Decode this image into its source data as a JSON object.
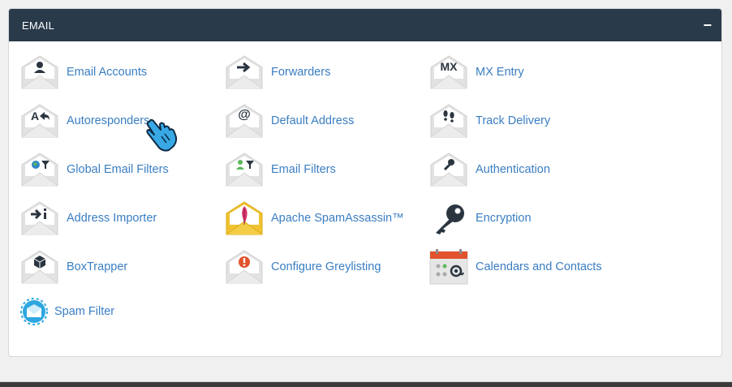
{
  "panel": {
    "title": "EMAIL",
    "collapse_symbol": "−"
  },
  "items": [
    {
      "label": "Email Accounts",
      "icon": "user-envelope-icon"
    },
    {
      "label": "Forwarders",
      "icon": "arrow-right-envelope-icon"
    },
    {
      "label": "MX Entry",
      "icon": "mx-envelope-icon",
      "glyph": "MX"
    },
    {
      "label": "Autoresponders",
      "icon": "reply-envelope-icon",
      "glyph": "A"
    },
    {
      "label": "Default Address",
      "icon": "at-envelope-icon",
      "glyph": "@"
    },
    {
      "label": "Track Delivery",
      "icon": "footprints-envelope-icon"
    },
    {
      "label": "Global Email Filters",
      "icon": "globe-filter-envelope-icon"
    },
    {
      "label": "Email Filters",
      "icon": "user-filter-envelope-icon"
    },
    {
      "label": "Authentication",
      "icon": "key-envelope-icon"
    },
    {
      "label": "Address Importer",
      "icon": "import-envelope-icon"
    },
    {
      "label": "Apache SpamAssassin™",
      "icon": "feather-envelope-icon"
    },
    {
      "label": "Encryption",
      "icon": "key-icon"
    },
    {
      "label": "BoxTrapper",
      "icon": "box-envelope-icon"
    },
    {
      "label": "Configure Greylisting",
      "icon": "alert-envelope-icon"
    },
    {
      "label": "Calendars and Contacts",
      "icon": "calendar-icon"
    },
    {
      "label": "Spam Filter",
      "icon": "spam-filter-icon"
    }
  ],
  "colors": {
    "header_bg": "#293a4a",
    "link": "#3a7ec2",
    "envelope": "#e0e0e0",
    "envelope_yellow": "#f0c22e",
    "calendar_red": "#e2522d",
    "spam_blue": "#2ea7e0"
  }
}
